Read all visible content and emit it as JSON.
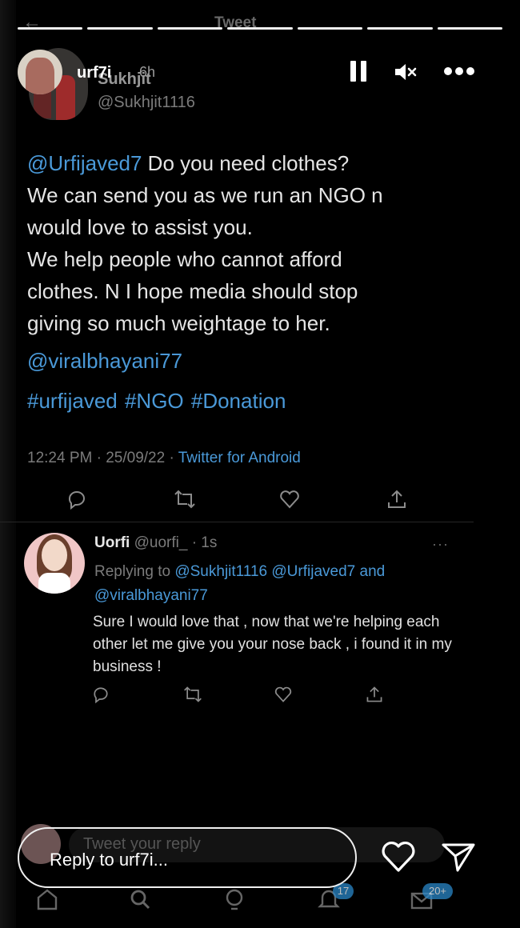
{
  "twitter_header": {
    "back_icon": "arrow-left-icon",
    "title": "Tweet"
  },
  "story": {
    "progress_segments": 7,
    "username": "urf7i",
    "time": "6h",
    "pause_icon": "pause-icon",
    "mute_icon": "speaker-muted-icon",
    "more_icon": "more-horizontal-icon"
  },
  "tweet": {
    "name": "Sukhjit",
    "handle": "@Sukhjit1116",
    "mention": "@Urfijaved7",
    "text_after_mention": " Do you need clothes?",
    "line2": "We can send you as we run an NGO n",
    "line3": "would love to assist you.",
    "line4": "We help people who cannot afford",
    "line5": "clothes. N I hope media should stop",
    "line6": "giving so much weightage to her.",
    "mention2": "@viralbhayani77",
    "hashtags": "#urfijaved #NGO #Donation",
    "timestamp": "12:24 PM · 25/09/22 · ",
    "source": "Twitter for Android"
  },
  "reply": {
    "name": "Uorfi",
    "handle_time": "@uorfi_ · 1s",
    "more": "···",
    "replying_prefix": "Replying to ",
    "replying_to": "@Sukhjit1116 @Urfijaved7",
    "replying_and": " and",
    "replying_to2": "@viralbhayani77",
    "text": "Sure I would love that , now that we're helping each other let me give you your nose back , i found it in my business !"
  },
  "composer": {
    "placeholder": "Tweet your reply"
  },
  "bottom_nav": {
    "notifications_badge": "17",
    "messages_badge": "20+"
  },
  "story_reply": {
    "placeholder": "Reply to urf7i..."
  },
  "colors": {
    "link": "#4a99d8",
    "background": "#000000",
    "text": "#e5e5e5"
  }
}
